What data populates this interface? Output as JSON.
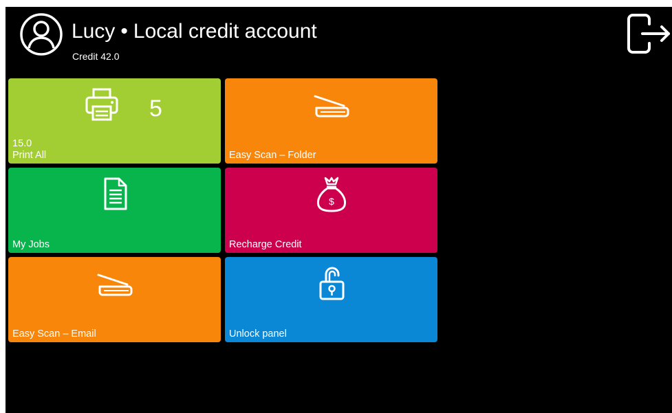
{
  "header": {
    "user_name": "Lucy",
    "separator": "•",
    "account_type": "Local credit account",
    "credit_text": "Credit 42.0"
  },
  "icons": {
    "avatar": "user-circle-icon",
    "logout": "logout-icon"
  },
  "tiles": [
    {
      "id": "print-all",
      "label": "Print All",
      "value": "15.0",
      "count": "5",
      "color": "#a3ce33",
      "icon": "printer-icon"
    },
    {
      "id": "easy-scan-folder",
      "label": "Easy Scan – Folder",
      "color": "#f7860b",
      "icon": "scanner-icon"
    },
    {
      "id": "my-jobs",
      "label": "My Jobs",
      "color": "#08b54d",
      "icon": "document-icon"
    },
    {
      "id": "recharge-credit",
      "label": "Recharge Credit",
      "color": "#cc004d",
      "icon": "money-bag-icon"
    },
    {
      "id": "easy-scan-email",
      "label": "Easy Scan – Email",
      "color": "#f7860b",
      "icon": "scanner-icon"
    },
    {
      "id": "unlock-panel",
      "label": "Unlock panel",
      "color": "#0a87d5",
      "icon": "unlocked-padlock-icon"
    }
  ]
}
